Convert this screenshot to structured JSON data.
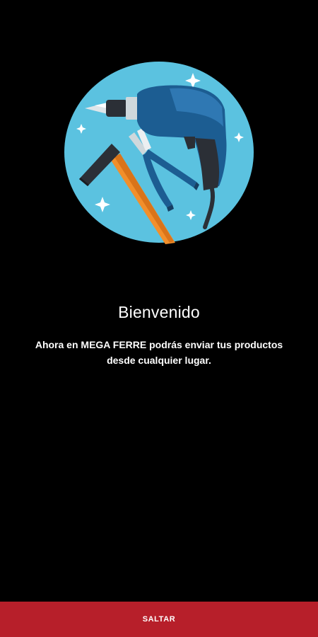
{
  "onboarding": {
    "title": "Bienvenido",
    "description": "Ahora en MEGA FERRE podrás enviar tus productos desde cualquier lugar.",
    "illustration_icon": "tools-illustration-icon"
  },
  "bottom_bar": {
    "skip_label": "SALTAR",
    "color": "#b71f2a"
  },
  "colors": {
    "background": "#000000",
    "illustration_circle": "#5bc2e0",
    "drill_body": "#1c5d92",
    "hammer_handle": "#f28f2b"
  }
}
